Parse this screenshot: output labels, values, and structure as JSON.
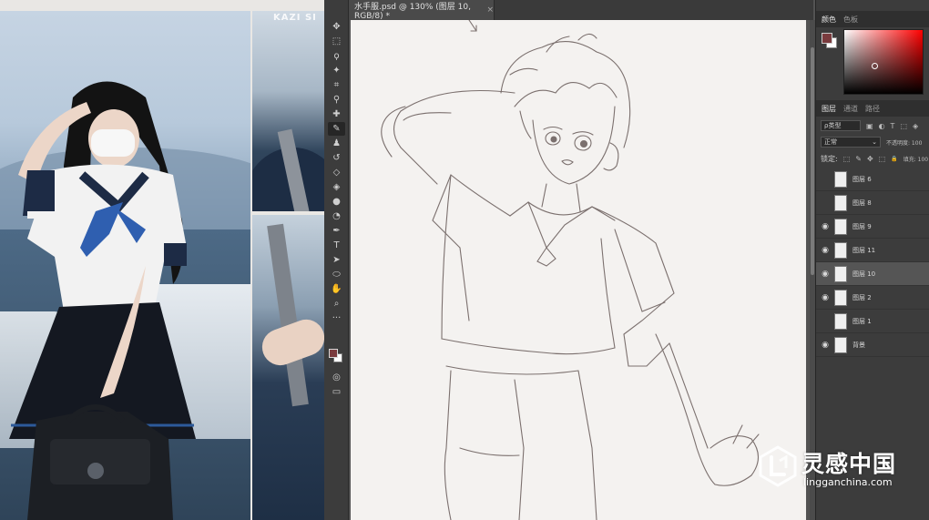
{
  "reference": {
    "watermark_text": "KAZI SI"
  },
  "document": {
    "tab_title": "水手服.psd @ 130% (图层 10, RGB/8) *",
    "close_glyph": "×"
  },
  "toolbar": {
    "tools": [
      {
        "icon": "move-icon",
        "glyph": "✥"
      },
      {
        "icon": "marquee-icon",
        "glyph": "⬚"
      },
      {
        "icon": "lasso-icon",
        "glyph": "ϙ"
      },
      {
        "icon": "magic-wand-icon",
        "glyph": "✦"
      },
      {
        "icon": "crop-icon",
        "glyph": "⌗"
      },
      {
        "icon": "eyedropper-icon",
        "glyph": "⚲"
      },
      {
        "icon": "healing-icon",
        "glyph": "✚"
      },
      {
        "icon": "brush-icon",
        "glyph": "✎",
        "active": true
      },
      {
        "icon": "stamp-icon",
        "glyph": "♟"
      },
      {
        "icon": "history-brush-icon",
        "glyph": "↺"
      },
      {
        "icon": "eraser-icon",
        "glyph": "◇"
      },
      {
        "icon": "bucket-icon",
        "glyph": "◈"
      },
      {
        "icon": "blur-icon",
        "glyph": "●"
      },
      {
        "icon": "dodge-icon",
        "glyph": "◔"
      },
      {
        "icon": "pen-icon",
        "glyph": "✒"
      },
      {
        "icon": "type-icon",
        "glyph": "T"
      },
      {
        "icon": "path-select-icon",
        "glyph": "➤"
      },
      {
        "icon": "shape-icon",
        "glyph": "⬭"
      },
      {
        "icon": "hand-icon",
        "glyph": "✋"
      },
      {
        "icon": "zoom-icon",
        "glyph": "⌕"
      },
      {
        "icon": "more-tools-icon",
        "glyph": "···"
      }
    ],
    "extras": [
      {
        "icon": "quick-mask-icon",
        "glyph": "◎"
      },
      {
        "icon": "screen-mode-icon",
        "glyph": "▭"
      }
    ]
  },
  "color_panel": {
    "tabs": [
      "颜色",
      "色板"
    ],
    "fg": "#7a3b3e",
    "bg": "#ffffff"
  },
  "layers_panel": {
    "tabs": [
      "图层",
      "通道",
      "路径"
    ],
    "filter_label": "ρ类型",
    "filter_icons": [
      "▣",
      "◐",
      "T",
      "⬚",
      "◈"
    ],
    "blend_mode": "正常",
    "opacity_label": "不透明度: 100",
    "lock_label": "锁定:",
    "lock_icons": [
      "⬚",
      "✎",
      "✥",
      "⬚",
      "🔒"
    ],
    "fill_label": "填充: 100",
    "layers": [
      {
        "name": "图层 6",
        "visible": false,
        "selected": false
      },
      {
        "name": "图层 8",
        "visible": false,
        "selected": false
      },
      {
        "name": "图层 9",
        "visible": true,
        "selected": false
      },
      {
        "name": "图层 11",
        "visible": true,
        "selected": false
      },
      {
        "name": "图层 10",
        "visible": true,
        "selected": true
      },
      {
        "name": "图层 2",
        "visible": true,
        "selected": false
      },
      {
        "name": "图层 1",
        "visible": false,
        "selected": false
      },
      {
        "name": "背景",
        "visible": true,
        "selected": false
      }
    ],
    "eye_glyph": "◉"
  },
  "watermark": {
    "title": "灵感中国",
    "subtitle": "lingganchina.com"
  }
}
